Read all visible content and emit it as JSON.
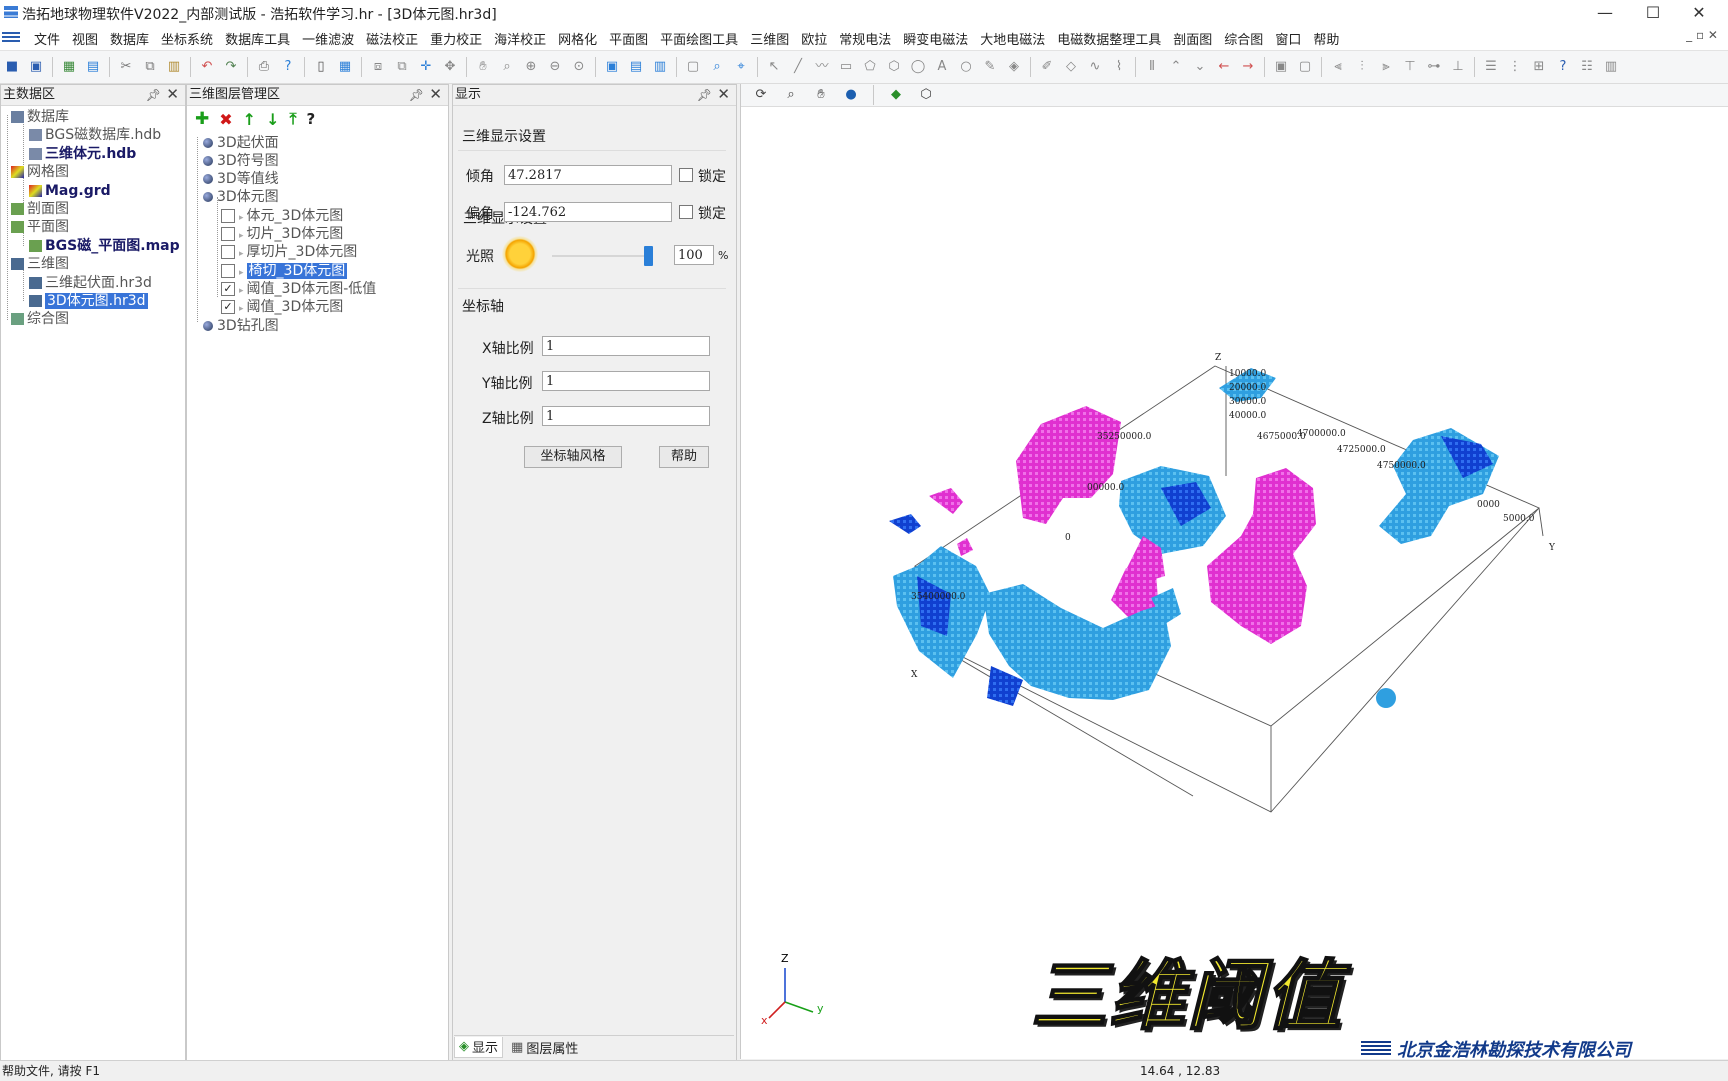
{
  "window": {
    "title": "浩拓地球物理软件V2022_内部测试版 - 浩拓软件学习.hr - [3D体元图.hr3d]",
    "minimize": "—",
    "maximize": "☐",
    "close": "✕"
  },
  "menu": [
    "文件",
    "视图",
    "数据库",
    "坐标系统",
    "数据库工具",
    "一维滤波",
    "磁法校正",
    "重力校正",
    "海洋校正",
    "网格化",
    "平面图",
    "平面绘图工具",
    "三维图",
    "欧拉",
    "常规电法",
    "瞬变电磁法",
    "大地电磁法",
    "电磁数据整理工具",
    "剖面图",
    "综合图",
    "窗口",
    "帮助"
  ],
  "mdi_controls": "_ ▫ ✕",
  "data_panel": {
    "title": "主数据区",
    "items": [
      {
        "label": "数据库"
      },
      {
        "label": "BGS磁数据库.hdb"
      },
      {
        "label": "三维体元.hdb"
      },
      {
        "label": "网格图"
      },
      {
        "label": "Mag.grd"
      },
      {
        "label": "剖面图"
      },
      {
        "label": "平面图"
      },
      {
        "label": "BGS磁_平面图.map"
      },
      {
        "label": "三维图"
      },
      {
        "label": "三维起伏面.hr3d"
      },
      {
        "label": "3D体元图.hr3d"
      },
      {
        "label": "综合图"
      }
    ]
  },
  "layer_panel": {
    "title": "三维图层管理区",
    "toolbar": {
      "add": "✚",
      "delete": "✖",
      "up": "↑",
      "down": "↓",
      "top": "⤒",
      "help": "?"
    },
    "items": [
      {
        "label": "3D起伏面"
      },
      {
        "label": "3D符号图"
      },
      {
        "label": "3D等值线"
      },
      {
        "label": "3D体元图"
      },
      {
        "label": "体元_3D体元图",
        "checked": false
      },
      {
        "label": "切片_3D体元图",
        "checked": false
      },
      {
        "label": "厚切片_3D体元图",
        "checked": false
      },
      {
        "label": "椅切_3D体元图",
        "checked": false
      },
      {
        "label": "阈值_3D体元图-低值",
        "checked": true
      },
      {
        "label": "阈值_3D体元图",
        "checked": true
      },
      {
        "label": "3D钻孔图"
      }
    ]
  },
  "display_panel": {
    "title": "显示",
    "section_3d": "三维显示设置",
    "tilt_label": "倾角",
    "tilt_value": "47.2817",
    "azimuth_label": "偏角",
    "azimuth_value": "-124.762",
    "lock_label": "锁定",
    "light_label": "光照",
    "light_value": "100",
    "light_unit": "%",
    "light_level": 1.0,
    "section_axis": "坐标轴",
    "x_label": "X轴比例",
    "x_value": "1",
    "y_label": "Y轴比例",
    "y_value": "1",
    "z_label": "Z轴比例",
    "z_value": "1",
    "axis_style_button": "坐标轴风格",
    "help_button": "帮助",
    "tab_display": "显示",
    "tab_layer_props": "图层属性"
  },
  "view3d": {
    "z_ticks": [
      "10000.0",
      "20000.0",
      "30000.0",
      "40000.0"
    ],
    "z_axis": "Z",
    "x_axis": "X",
    "y_axis": "Y",
    "y_ticks": [
      "4675000.0",
      "4700000.0",
      "4725000.0",
      "4750000.0"
    ],
    "x_ticks": [
      "35250000.0",
      "35400000.0"
    ],
    "partial_labels": [
      "00000.0",
      "0",
      "0000",
      "5000.0"
    ],
    "triad": {
      "z": "Z",
      "y": "y",
      "x": "x"
    },
    "overlay_caption": "三维阈值",
    "company": "北京金浩林勘探技术有限公司"
  },
  "status": {
    "help_text": "帮助文件, 请按 F1",
    "coords": "14.64 , 12.83"
  },
  "colors": {
    "selection": "#3874d8",
    "high_value": "#e030d0",
    "low_value": "#2f9fe0",
    "deep_low": "#1040d0",
    "caption_fill": "#f2e82e"
  }
}
